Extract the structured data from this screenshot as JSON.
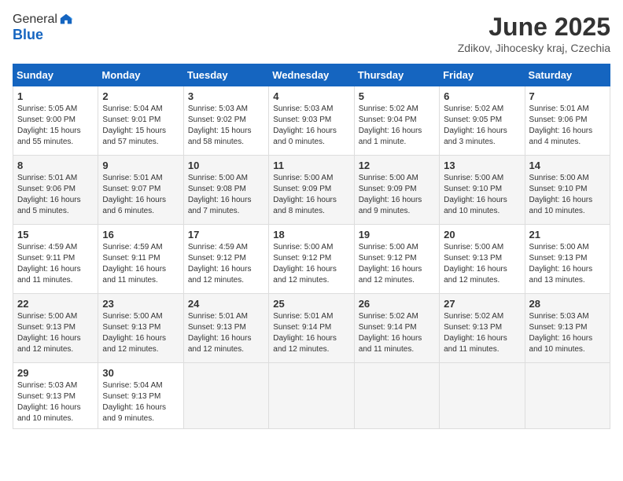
{
  "logo": {
    "general": "General",
    "blue": "Blue"
  },
  "header": {
    "month_title": "June 2025",
    "location": "Zdikov, Jihocesky kraj, Czechia"
  },
  "weekdays": [
    "Sunday",
    "Monday",
    "Tuesday",
    "Wednesday",
    "Thursday",
    "Friday",
    "Saturday"
  ],
  "weeks": [
    [
      {
        "day": "1",
        "lines": [
          "Sunrise: 5:05 AM",
          "Sunset: 9:00 PM",
          "Daylight: 15 hours",
          "and 55 minutes."
        ]
      },
      {
        "day": "2",
        "lines": [
          "Sunrise: 5:04 AM",
          "Sunset: 9:01 PM",
          "Daylight: 15 hours",
          "and 57 minutes."
        ]
      },
      {
        "day": "3",
        "lines": [
          "Sunrise: 5:03 AM",
          "Sunset: 9:02 PM",
          "Daylight: 15 hours",
          "and 58 minutes."
        ]
      },
      {
        "day": "4",
        "lines": [
          "Sunrise: 5:03 AM",
          "Sunset: 9:03 PM",
          "Daylight: 16 hours",
          "and 0 minutes."
        ]
      },
      {
        "day": "5",
        "lines": [
          "Sunrise: 5:02 AM",
          "Sunset: 9:04 PM",
          "Daylight: 16 hours",
          "and 1 minute."
        ]
      },
      {
        "day": "6",
        "lines": [
          "Sunrise: 5:02 AM",
          "Sunset: 9:05 PM",
          "Daylight: 16 hours",
          "and 3 minutes."
        ]
      },
      {
        "day": "7",
        "lines": [
          "Sunrise: 5:01 AM",
          "Sunset: 9:06 PM",
          "Daylight: 16 hours",
          "and 4 minutes."
        ]
      }
    ],
    [
      {
        "day": "8",
        "lines": [
          "Sunrise: 5:01 AM",
          "Sunset: 9:06 PM",
          "Daylight: 16 hours",
          "and 5 minutes."
        ]
      },
      {
        "day": "9",
        "lines": [
          "Sunrise: 5:01 AM",
          "Sunset: 9:07 PM",
          "Daylight: 16 hours",
          "and 6 minutes."
        ]
      },
      {
        "day": "10",
        "lines": [
          "Sunrise: 5:00 AM",
          "Sunset: 9:08 PM",
          "Daylight: 16 hours",
          "and 7 minutes."
        ]
      },
      {
        "day": "11",
        "lines": [
          "Sunrise: 5:00 AM",
          "Sunset: 9:09 PM",
          "Daylight: 16 hours",
          "and 8 minutes."
        ]
      },
      {
        "day": "12",
        "lines": [
          "Sunrise: 5:00 AM",
          "Sunset: 9:09 PM",
          "Daylight: 16 hours",
          "and 9 minutes."
        ]
      },
      {
        "day": "13",
        "lines": [
          "Sunrise: 5:00 AM",
          "Sunset: 9:10 PM",
          "Daylight: 16 hours",
          "and 10 minutes."
        ]
      },
      {
        "day": "14",
        "lines": [
          "Sunrise: 5:00 AM",
          "Sunset: 9:10 PM",
          "Daylight: 16 hours",
          "and 10 minutes."
        ]
      }
    ],
    [
      {
        "day": "15",
        "lines": [
          "Sunrise: 4:59 AM",
          "Sunset: 9:11 PM",
          "Daylight: 16 hours",
          "and 11 minutes."
        ]
      },
      {
        "day": "16",
        "lines": [
          "Sunrise: 4:59 AM",
          "Sunset: 9:11 PM",
          "Daylight: 16 hours",
          "and 11 minutes."
        ]
      },
      {
        "day": "17",
        "lines": [
          "Sunrise: 4:59 AM",
          "Sunset: 9:12 PM",
          "Daylight: 16 hours",
          "and 12 minutes."
        ]
      },
      {
        "day": "18",
        "lines": [
          "Sunrise: 5:00 AM",
          "Sunset: 9:12 PM",
          "Daylight: 16 hours",
          "and 12 minutes."
        ]
      },
      {
        "day": "19",
        "lines": [
          "Sunrise: 5:00 AM",
          "Sunset: 9:12 PM",
          "Daylight: 16 hours",
          "and 12 minutes."
        ]
      },
      {
        "day": "20",
        "lines": [
          "Sunrise: 5:00 AM",
          "Sunset: 9:13 PM",
          "Daylight: 16 hours",
          "and 12 minutes."
        ]
      },
      {
        "day": "21",
        "lines": [
          "Sunrise: 5:00 AM",
          "Sunset: 9:13 PM",
          "Daylight: 16 hours",
          "and 13 minutes."
        ]
      }
    ],
    [
      {
        "day": "22",
        "lines": [
          "Sunrise: 5:00 AM",
          "Sunset: 9:13 PM",
          "Daylight: 16 hours",
          "and 12 minutes."
        ]
      },
      {
        "day": "23",
        "lines": [
          "Sunrise: 5:00 AM",
          "Sunset: 9:13 PM",
          "Daylight: 16 hours",
          "and 12 minutes."
        ]
      },
      {
        "day": "24",
        "lines": [
          "Sunrise: 5:01 AM",
          "Sunset: 9:13 PM",
          "Daylight: 16 hours",
          "and 12 minutes."
        ]
      },
      {
        "day": "25",
        "lines": [
          "Sunrise: 5:01 AM",
          "Sunset: 9:14 PM",
          "Daylight: 16 hours",
          "and 12 minutes."
        ]
      },
      {
        "day": "26",
        "lines": [
          "Sunrise: 5:02 AM",
          "Sunset: 9:14 PM",
          "Daylight: 16 hours",
          "and 11 minutes."
        ]
      },
      {
        "day": "27",
        "lines": [
          "Sunrise: 5:02 AM",
          "Sunset: 9:13 PM",
          "Daylight: 16 hours",
          "and 11 minutes."
        ]
      },
      {
        "day": "28",
        "lines": [
          "Sunrise: 5:03 AM",
          "Sunset: 9:13 PM",
          "Daylight: 16 hours",
          "and 10 minutes."
        ]
      }
    ],
    [
      {
        "day": "29",
        "lines": [
          "Sunrise: 5:03 AM",
          "Sunset: 9:13 PM",
          "Daylight: 16 hours",
          "and 10 minutes."
        ]
      },
      {
        "day": "30",
        "lines": [
          "Sunrise: 5:04 AM",
          "Sunset: 9:13 PM",
          "Daylight: 16 hours",
          "and 9 minutes."
        ]
      },
      {
        "day": "",
        "lines": []
      },
      {
        "day": "",
        "lines": []
      },
      {
        "day": "",
        "lines": []
      },
      {
        "day": "",
        "lines": []
      },
      {
        "day": "",
        "lines": []
      }
    ]
  ]
}
